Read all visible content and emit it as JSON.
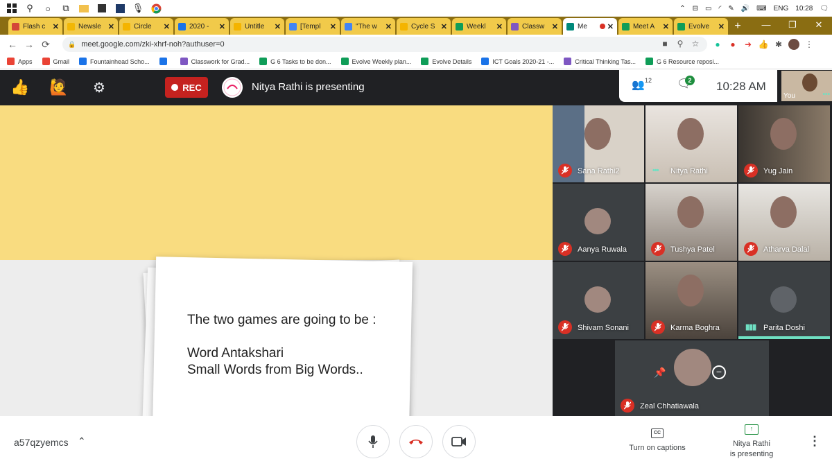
{
  "taskbar": {
    "lang": "ENG",
    "time": "10:28"
  },
  "tabs": [
    {
      "label": "Flash c",
      "color": "#d44638"
    },
    {
      "label": "Newsle",
      "color": "#f2b705"
    },
    {
      "label": "Circle",
      "color": "#f4b400"
    },
    {
      "label": "2020 -",
      "color": "#1a73e8"
    },
    {
      "label": "Untitle",
      "color": "#f4b400"
    },
    {
      "label": "[Templ",
      "color": "#4285f4"
    },
    {
      "label": "\"The w",
      "color": "#4285f4"
    },
    {
      "label": "Cycle S",
      "color": "#f4b400"
    },
    {
      "label": "Weekl",
      "color": "#0f9d58"
    },
    {
      "label": "Classw",
      "color": "#7e57c2"
    },
    {
      "label": "Me",
      "color": "#00897b"
    },
    {
      "label": "Meet A",
      "color": "#0f9d58"
    },
    {
      "label": "Evolve",
      "color": "#0f9d58"
    }
  ],
  "address": {
    "url": "meet.google.com/zki-xhrf-noh?authuser=0"
  },
  "bookmarks": [
    {
      "label": "Apps",
      "color": "#ea4335"
    },
    {
      "label": "Gmail",
      "color": "#ea4335"
    },
    {
      "label": "Fountainhead Scho...",
      "color": "#1a73e8"
    },
    {
      "label": "",
      "color": "#1a73e8"
    },
    {
      "label": "Classwork for Grad...",
      "color": "#7e57c2"
    },
    {
      "label": "G 6 Tasks to be don...",
      "color": "#0f9d58"
    },
    {
      "label": "Evolve Weekly plan...",
      "color": "#0f9d58"
    },
    {
      "label": "Evolve Details",
      "color": "#0f9d58"
    },
    {
      "label": "ICT Goals 2020-21 -...",
      "color": "#1a73e8"
    },
    {
      "label": "Critical Thinking Tas...",
      "color": "#7e57c2"
    },
    {
      "label": "G 6 Resource reposi...",
      "color": "#0f9d58"
    }
  ],
  "meet": {
    "rec_label": "REC",
    "presenting_label": "Nitya Rathi is presenting",
    "people_count": "12",
    "chat_badge": "2",
    "clock": "10:28 AM",
    "self_label": "You"
  },
  "slide": {
    "line1": "The two games are going to be :",
    "line2": "Word Antakshari",
    "line3": "Small Words from Big Words.."
  },
  "participants": [
    {
      "name": "Sana Rathi2",
      "muted": true
    },
    {
      "name": "Nitya Rathi",
      "muted": false
    },
    {
      "name": "Yug Jain",
      "muted": true
    },
    {
      "name": "Aanya Ruwala",
      "muted": true
    },
    {
      "name": "Tushya Patel",
      "muted": true
    },
    {
      "name": "Atharva Dalal",
      "muted": true
    },
    {
      "name": "Shivam Sonani",
      "muted": true
    },
    {
      "name": "Karma Boghra",
      "muted": true
    },
    {
      "name": "Parita Doshi",
      "muted": false
    },
    {
      "name": "Zeal Chhatiawala",
      "muted": true
    }
  ],
  "bottom": {
    "meeting_code": "a57qzyemcs",
    "captions_label": "Turn on captions",
    "presenting_line1": "Nitya Rathi",
    "presenting_line2": "is presenting"
  }
}
